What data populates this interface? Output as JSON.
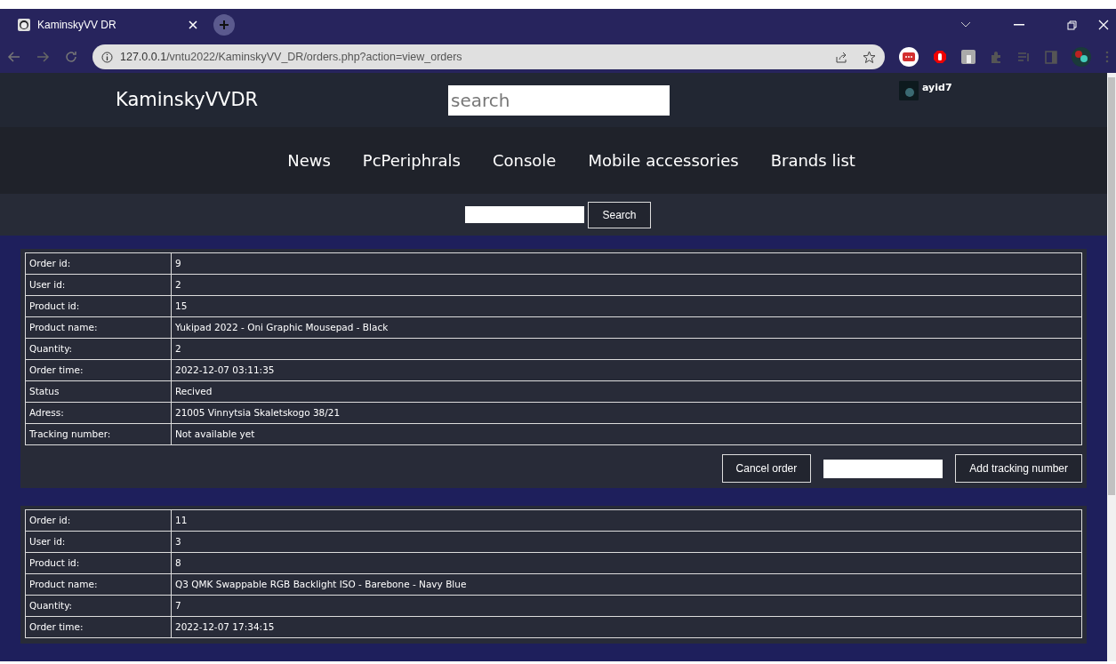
{
  "browser": {
    "tab_title": "KaminskyVV DR",
    "url_host": "127.0.0.1",
    "url_path": "/vntu2022/KaminskyVV_DR/orders.php?action=view_orders"
  },
  "header": {
    "logo": "KaminskyVVDR",
    "search_placeholder": "search",
    "username": "ayid7"
  },
  "nav": [
    "News",
    "PcPeriphrals",
    "Console",
    "Mobile accessories",
    "Brands list"
  ],
  "order_search": {
    "button": "Search"
  },
  "orders": [
    {
      "rows": [
        {
          "label": "Order id:",
          "value": "9"
        },
        {
          "label": "User id:",
          "value": "2"
        },
        {
          "label": "Product id:",
          "value": "15"
        },
        {
          "label": "Product name:",
          "value": "Yukipad 2022 - Oni Graphic Mousepad - Black"
        },
        {
          "label": "Quantity:",
          "value": "2"
        },
        {
          "label": "Order time:",
          "value": "2022-12-07 03:11:35"
        },
        {
          "label": "Status",
          "value": "Recived"
        },
        {
          "label": "Adress:",
          "value": "21005 Vinnytsia Skaletskogo 38/21"
        },
        {
          "label": "Tracking number:",
          "value": "Not available yet"
        }
      ],
      "actions": {
        "cancel": "Cancel order",
        "add_tracking": "Add tracking number"
      }
    },
    {
      "rows": [
        {
          "label": "Order id:",
          "value": "11"
        },
        {
          "label": "User id:",
          "value": "3"
        },
        {
          "label": "Product id:",
          "value": "8"
        },
        {
          "label": "Product name:",
          "value": "Q3 QMK Swappable RGB Backlight ISO - Barebone - Navy Blue"
        },
        {
          "label": "Quantity:",
          "value": "7"
        },
        {
          "label": "Order time:",
          "value": "2022-12-07 17:34:15"
        }
      ]
    }
  ]
}
